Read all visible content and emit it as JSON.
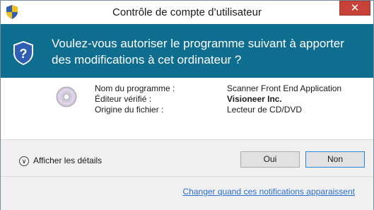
{
  "window": {
    "title": "Contrôle de compte d’utilisateur",
    "close_label": "✕"
  },
  "banner": {
    "message": "Voulez-vous autoriser le programme suivant à apporter des modifications à cet ordinateur ?"
  },
  "details_panel": {
    "labels": [
      "Nom du programme :",
      "Éditeur vérifié :",
      "Origine du fichier :"
    ],
    "values": [
      "Scanner Front End Application",
      "Visioneer Inc.",
      "Lecteur de CD/DVD"
    ]
  },
  "footer": {
    "details_label": "Afficher les détails",
    "yes_label": "Oui",
    "no_label": "Non",
    "link_text": "Changer quand ces notifications apparaissent"
  },
  "icons": {
    "shield": "uac-shield-icon",
    "disc": "cd-dvd-icon",
    "chevron": "chevron-down-circle-icon"
  },
  "colors": {
    "banner": "#0f6e8f",
    "close": "#c7433a",
    "link": "#2a6fd1"
  }
}
